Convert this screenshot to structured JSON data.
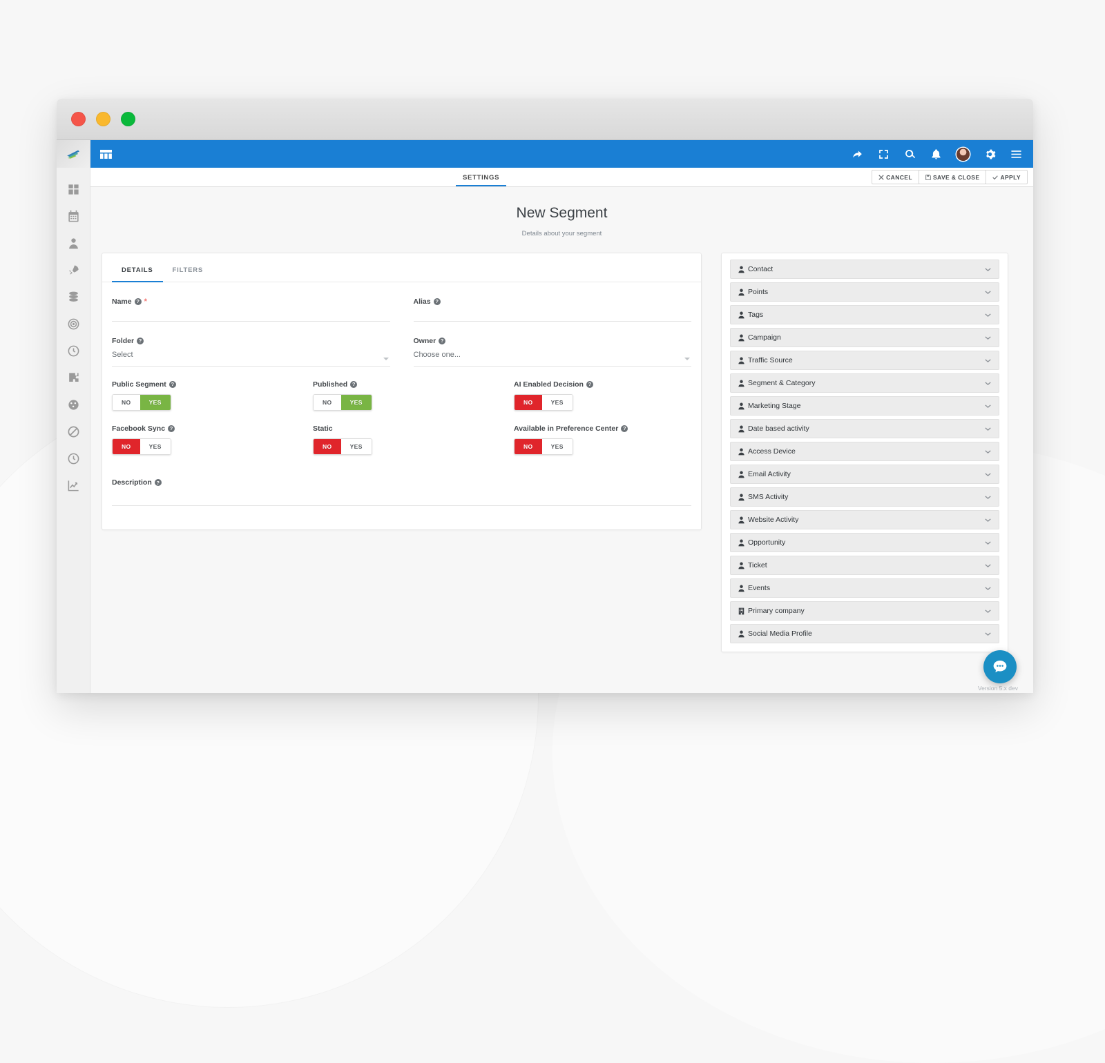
{
  "window": {
    "traffic_lights": [
      "close",
      "minimize",
      "zoom"
    ]
  },
  "topbar": {
    "logo_alt": "mautic-logo",
    "grid_icon": "grid-icon",
    "icons": [
      "share-icon",
      "fullscreen-icon",
      "search-icon",
      "bell-icon",
      "avatar",
      "gear-icon",
      "hamburger-icon"
    ],
    "accent_color": "#1a7fd4"
  },
  "actionbar": {
    "tab_label": "SETTINGS",
    "cancel_label": "CANCEL",
    "save_close_label": "SAVE & CLOSE",
    "apply_label": "APPLY"
  },
  "page": {
    "title": "New Segment",
    "subtitle": "Details about your segment"
  },
  "card_tabs": [
    {
      "label": "DETAILS",
      "active": true
    },
    {
      "label": "FILTERS",
      "active": false
    }
  ],
  "form": {
    "name": {
      "label": "Name",
      "value": "",
      "required": true,
      "help": "?"
    },
    "alias": {
      "label": "Alias",
      "value": "",
      "help": "?"
    },
    "folder": {
      "label": "Folder",
      "value": "Select",
      "help": "?"
    },
    "owner": {
      "label": "Owner",
      "value": "Choose one...",
      "help": "?"
    },
    "description": {
      "label": "Description",
      "value": "",
      "help": "?"
    },
    "toggles": [
      {
        "label": "Public Segment",
        "help": true,
        "no": "NO",
        "yes": "YES",
        "state": "yes"
      },
      {
        "label": "Published",
        "help": true,
        "no": "NO",
        "yes": "YES",
        "state": "yes"
      },
      {
        "label": "AI Enabled Decision",
        "help": true,
        "no": "NO",
        "yes": "YES",
        "state": "no"
      },
      {
        "label": "Facebook Sync",
        "help": true,
        "no": "NO",
        "yes": "YES",
        "state": "no"
      },
      {
        "label": "Static",
        "help": false,
        "no": "NO",
        "yes": "YES",
        "state": "no"
      },
      {
        "label": "Available in Preference Center",
        "help": true,
        "no": "NO",
        "yes": "YES",
        "state": "no"
      }
    ],
    "colors": {
      "yes_on": "#79b544",
      "no_on": "#e0252b"
    }
  },
  "accordion": {
    "items": [
      {
        "label": "Contact",
        "icon": "user-icon"
      },
      {
        "label": "Points",
        "icon": "user-icon"
      },
      {
        "label": "Tags",
        "icon": "user-icon"
      },
      {
        "label": "Campaign",
        "icon": "user-icon"
      },
      {
        "label": "Traffic Source",
        "icon": "user-icon"
      },
      {
        "label": "Segment & Category",
        "icon": "user-icon"
      },
      {
        "label": "Marketing Stage",
        "icon": "user-icon"
      },
      {
        "label": "Date based activity",
        "icon": "user-icon"
      },
      {
        "label": "Access Device",
        "icon": "user-icon"
      },
      {
        "label": "Email Activity",
        "icon": "user-icon"
      },
      {
        "label": "SMS Activity",
        "icon": "user-icon"
      },
      {
        "label": "Website Activity",
        "icon": "user-icon"
      },
      {
        "label": "Opportunity",
        "icon": "user-icon"
      },
      {
        "label": "Ticket",
        "icon": "user-icon"
      },
      {
        "label": "Events",
        "icon": "user-icon"
      },
      {
        "label": "Primary company",
        "icon": "building-icon"
      },
      {
        "label": "Social Media Profile",
        "icon": "user-icon"
      }
    ]
  },
  "sidebar": {
    "items": [
      {
        "name": "dashboard",
        "icon": "grid-icon"
      },
      {
        "name": "calendar",
        "icon": "calendar-icon"
      },
      {
        "name": "contacts",
        "icon": "user-icon"
      },
      {
        "name": "campaigns",
        "icon": "rocket-icon"
      },
      {
        "name": "channels",
        "icon": "database-icon"
      },
      {
        "name": "points",
        "icon": "target-icon"
      },
      {
        "name": "stages",
        "icon": "clock-icon"
      },
      {
        "name": "plugins",
        "icon": "puzzle-icon"
      },
      {
        "name": "reports",
        "icon": "gauge-icon"
      },
      {
        "name": "blocked",
        "icon": "ban-icon"
      },
      {
        "name": "scheduler",
        "icon": "clock-icon"
      },
      {
        "name": "analytics",
        "icon": "chart-icon"
      }
    ]
  },
  "chat": {
    "icon": "chat-bubble-icon",
    "color": "#1b8fc4"
  },
  "footer": {
    "version": "Version 5.x dev"
  }
}
